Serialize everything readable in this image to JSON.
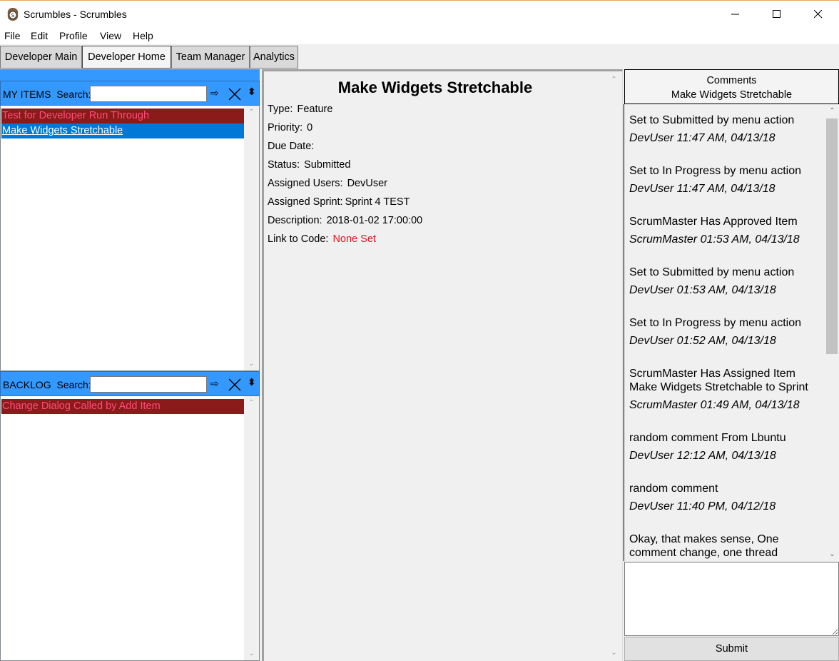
{
  "window": {
    "title": "Scrumbles - Scrumbles",
    "app_icon": "scrumbles-logo-icon"
  },
  "menu": [
    "File",
    "Edit",
    "Profile",
    "View",
    "Help"
  ],
  "tabs": [
    "Developer Main",
    "Developer Home",
    "Team Manager",
    "Analytics"
  ],
  "active_tab": "Developer Home",
  "colors": {
    "accent_blue": "#3399ff",
    "item_red_bg": "#8b1a1a",
    "item_red_text": "#ff4d7a",
    "selection": "#0078d7",
    "link_red": "#e81123"
  },
  "my_items": {
    "label": "MY ITEMS",
    "search_label": "Search:",
    "search_value": "",
    "go_icon": "⇨",
    "sort_icon": "⬍",
    "items": [
      "Test for Developer Run Through",
      "Make Widgets Stretchable"
    ]
  },
  "backlog": {
    "label": "BACKLOG",
    "search_label": "Search:",
    "search_value": "",
    "go_icon": "⇨",
    "sort_icon": "⬍",
    "items": [
      "Change Dialog Called by Add Item"
    ]
  },
  "detail": {
    "title": "Make Widgets Stretchable",
    "type_label": "Type:",
    "type": "Feature",
    "priority_label": "Priority:",
    "priority": "0",
    "due_label": "Due Date:",
    "due": "",
    "status_label": "Status:",
    "status": "Submitted",
    "users_label": "Assigned Users:",
    "users": "DevUser",
    "sprint_label": "Assigned Sprint:",
    "sprint": "Sprint 4 TEST",
    "desc_label": "Description:",
    "desc": "2018-01-02 17:00:00",
    "link_label": "Link to Code:",
    "link": "None Set"
  },
  "comments": {
    "header": "Comments",
    "subheader": "Make Widgets Stretchable",
    "items": [
      {
        "text": "Set to Submitted by menu action",
        "meta": "DevUser 11:47 AM, 04/13/18"
      },
      {
        "text": "Set to In Progress by menu action",
        "meta": "DevUser 11:47 AM, 04/13/18"
      },
      {
        "text": "ScrumMaster Has Approved Item",
        "meta": "ScrumMaster 01:53 AM, 04/13/18"
      },
      {
        "text": "Set to Submitted by menu action",
        "meta": "DevUser 01:53 AM, 04/13/18"
      },
      {
        "text": "Set to In Progress by menu action",
        "meta": "DevUser 01:52 AM, 04/13/18"
      },
      {
        "text": "ScrumMaster Has Assigned Item Make Widgets Stretchable to Sprint",
        "meta": "ScrumMaster 01:49 AM, 04/13/18"
      },
      {
        "text": "random comment From Lbuntu",
        "meta": "DevUser 12:12 AM, 04/13/18"
      },
      {
        "text": "random comment",
        "meta": "DevUser 11:40 PM, 04/12/18"
      },
      {
        "text": "Okay, that makes sense,  One comment change, one thread",
        "meta": ""
      }
    ],
    "input_value": "",
    "submit_label": "Submit"
  }
}
